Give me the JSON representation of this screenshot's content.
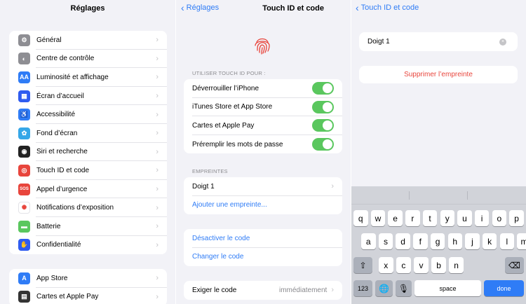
{
  "screen1": {
    "title": "Réglages",
    "groups": [
      [
        {
          "label": "Général",
          "icon": "gear-icon",
          "color": "#8e8e93"
        },
        {
          "label": "Centre de contrôle",
          "icon": "toggles-icon",
          "color": "#8e8e93"
        },
        {
          "label": "Luminosité et affichage",
          "icon": "text-size-icon",
          "color": "#2f7cf6",
          "glyph": "AA"
        },
        {
          "label": "Écran d’accueil",
          "icon": "home-grid-icon",
          "color": "#2f5cf0"
        },
        {
          "label": "Accessibilité",
          "icon": "accessibility-icon",
          "color": "#2f7cf6"
        },
        {
          "label": "Fond d’écran",
          "icon": "flower-icon",
          "color": "#35a7e8"
        },
        {
          "label": "Siri et recherche",
          "icon": "siri-icon",
          "color": "#222222"
        },
        {
          "label": "Touch ID et code",
          "icon": "fingerprint-icon",
          "color": "#e8453c"
        },
        {
          "label": "Appel d’urgence",
          "icon": "sos-icon",
          "color": "#e8453c",
          "glyph": "SOS"
        },
        {
          "label": "Notifications d’exposition",
          "icon": "exposure-icon",
          "color": "#ffffff"
        },
        {
          "label": "Batterie",
          "icon": "battery-icon",
          "color": "#5ac75e"
        },
        {
          "label": "Confidentialité",
          "icon": "hand-icon",
          "color": "#2f5cf0"
        }
      ],
      [
        {
          "label": "App Store",
          "icon": "app-store-icon",
          "color": "#2f7cf6"
        },
        {
          "label": "Cartes et Apple Pay",
          "icon": "wallet-icon",
          "color": "#333333"
        }
      ]
    ]
  },
  "screen2": {
    "back": "Réglages",
    "title": "Touch ID et code",
    "section1_label": "UTILISER TOUCH ID POUR :",
    "toggles": [
      {
        "label": "Déverrouiller l’iPhone",
        "on": true
      },
      {
        "label": "iTunes Store et App Store",
        "on": true
      },
      {
        "label": "Cartes et Apple Pay",
        "on": true
      },
      {
        "label": "Préremplir les mots de passe",
        "on": true
      }
    ],
    "section2_label": "EMPREINTES",
    "fingerprint_row": "Doigt 1",
    "add_fingerprint": "Ajouter une empreinte...",
    "disable_code": "Désactiver le code",
    "change_code": "Changer le code",
    "require_code_label": "Exiger le code",
    "require_code_value": "immédiatement"
  },
  "screen3": {
    "back": "Touch ID et code",
    "name_value": "Doigt 1",
    "delete_label": "Supprimer l’empreinte",
    "keyboard": {
      "row1": [
        "q",
        "w",
        "e",
        "r",
        "t",
        "y",
        "u",
        "i",
        "o",
        "p"
      ],
      "row2": [
        "a",
        "s",
        "d",
        "f",
        "g",
        "h",
        "j",
        "k",
        "l",
        "m"
      ],
      "row3": [
        "x",
        "c",
        "v",
        "b",
        "n"
      ],
      "numbers": "123",
      "space": "space",
      "done": "done"
    }
  },
  "colors": {
    "accent": "#2f7cf6",
    "toggle_on": "#5ac75e",
    "destructive": "#e8453c"
  }
}
